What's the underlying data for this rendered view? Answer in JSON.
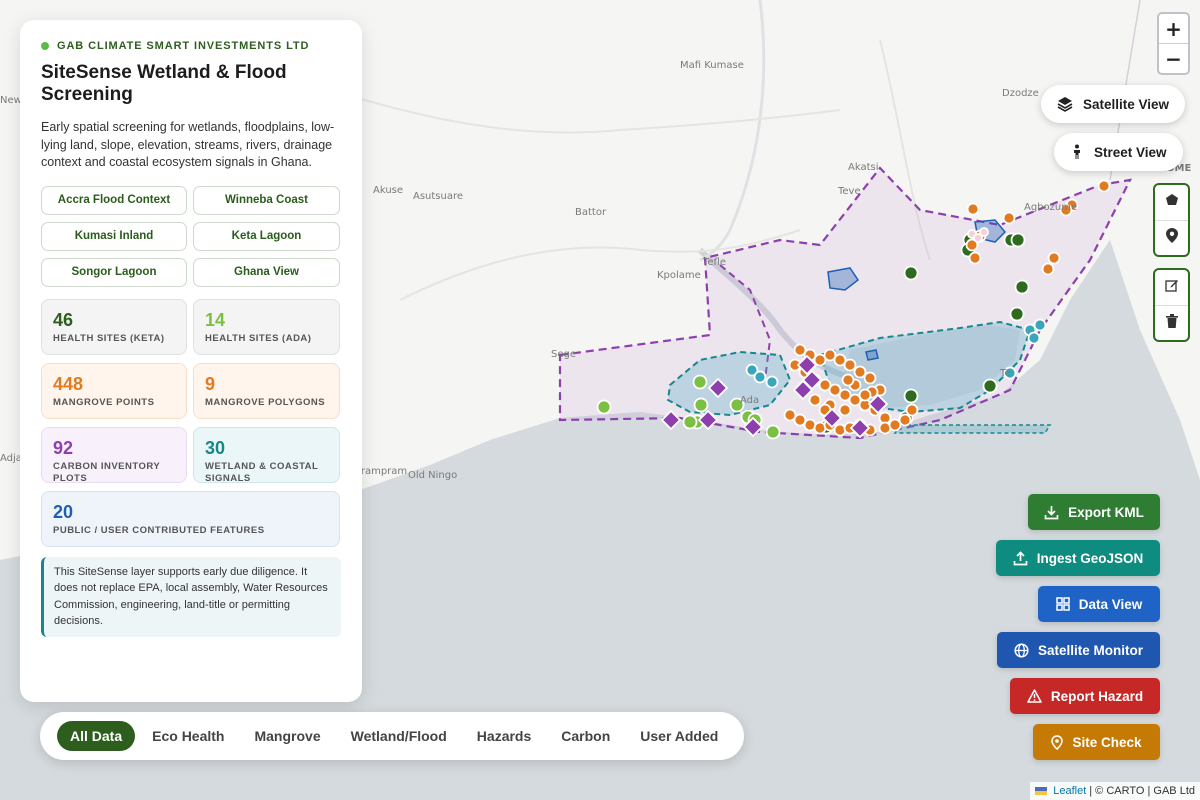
{
  "panel": {
    "org": "GAB CLIMATE SMART INVESTMENTS LTD",
    "title": "SiteSense Wetland & Flood Screening",
    "description": "Early spatial screening for wetlands, floodplains, low-lying land, slope, elevation, streams, rivers, drainage context and coastal ecosystem signals in Ghana.",
    "presets": [
      "Accra Flood Context",
      "Winneba Coast",
      "Kumasi Inland",
      "Keta Lagoon",
      "Songor Lagoon",
      "Ghana View"
    ],
    "stats": [
      {
        "value": "46",
        "label": "HEALTH SITES (KETA)",
        "color": "#2e5e1e",
        "bg": "#f3f4f3",
        "border": "#dfe2de"
      },
      {
        "value": "14",
        "label": "HEALTH SITES (ADA)",
        "color": "#7cc043",
        "bg": "#f3f4f3",
        "border": "#dfe2de"
      },
      {
        "value": "448",
        "label": "MANGROVE POINTS",
        "color": "#e07b22",
        "bg": "#fff5ec",
        "border": "#f6dfc9"
      },
      {
        "value": "9",
        "label": "MANGROVE POLYGONS",
        "color": "#e07b22",
        "bg": "#fff5ec",
        "border": "#f6dfc9"
      },
      {
        "value": "92",
        "label": "CARBON INVENTORY PLOTS",
        "color": "#8e3fae",
        "bg": "#f8f1fb",
        "border": "#eadcf1"
      },
      {
        "value": "30",
        "label": "WETLAND & COASTAL SIGNALS",
        "color": "#16888c",
        "bg": "#eaf6f8",
        "border": "#cfe6ea"
      },
      {
        "value": "20",
        "label": "PUBLIC / USER CONTRIBUTED FEATURES",
        "color": "#1e5fb5",
        "bg": "#eef4fa",
        "border": "#d6e3f1"
      }
    ],
    "note": "This SiteSense layer supports early due diligence. It does not replace EPA, local assembly, Water Resources Commission, engineering, land-title or permitting decisions."
  },
  "map_controls": {
    "zoom_in": "+",
    "zoom_out": "−",
    "satellite_view": "Satellite View",
    "street_view": "Street View"
  },
  "actions": [
    {
      "label": "Export KML",
      "icon": "download-icon",
      "color": "#2e7d32"
    },
    {
      "label": "Ingest GeoJSON",
      "icon": "upload-icon",
      "color": "#0e8c80"
    },
    {
      "label": "Data View",
      "icon": "grid-icon",
      "color": "#1f63c6"
    },
    {
      "label": "Satellite Monitor",
      "icon": "globe-icon",
      "color": "#1e56b0"
    },
    {
      "label": "Report Hazard",
      "icon": "warning-icon",
      "color": "#c62828"
    },
    {
      "label": "Site Check",
      "icon": "pin-icon",
      "color": "#c67a06"
    }
  ],
  "filters": [
    "All Data",
    "Eco Health",
    "Mangrove",
    "Wetland/Flood",
    "Hazards",
    "Carbon",
    "User Added"
  ],
  "active_filter": "All Data",
  "map_labels": [
    "Mafi Kumase",
    "Dzodze",
    "Akatsi",
    "Teve",
    "Akuse",
    "Asutsuare",
    "Battor",
    "Kpolame",
    "Tefle",
    "Agbozume",
    "Sege",
    "Ada",
    "Te",
    "Old Ningo",
    "Prampram",
    "Adja",
    "New",
    "LOME"
  ],
  "attribution": {
    "leaflet": "Leaflet",
    "rest": "| © CARTO | GAB Ltd"
  }
}
